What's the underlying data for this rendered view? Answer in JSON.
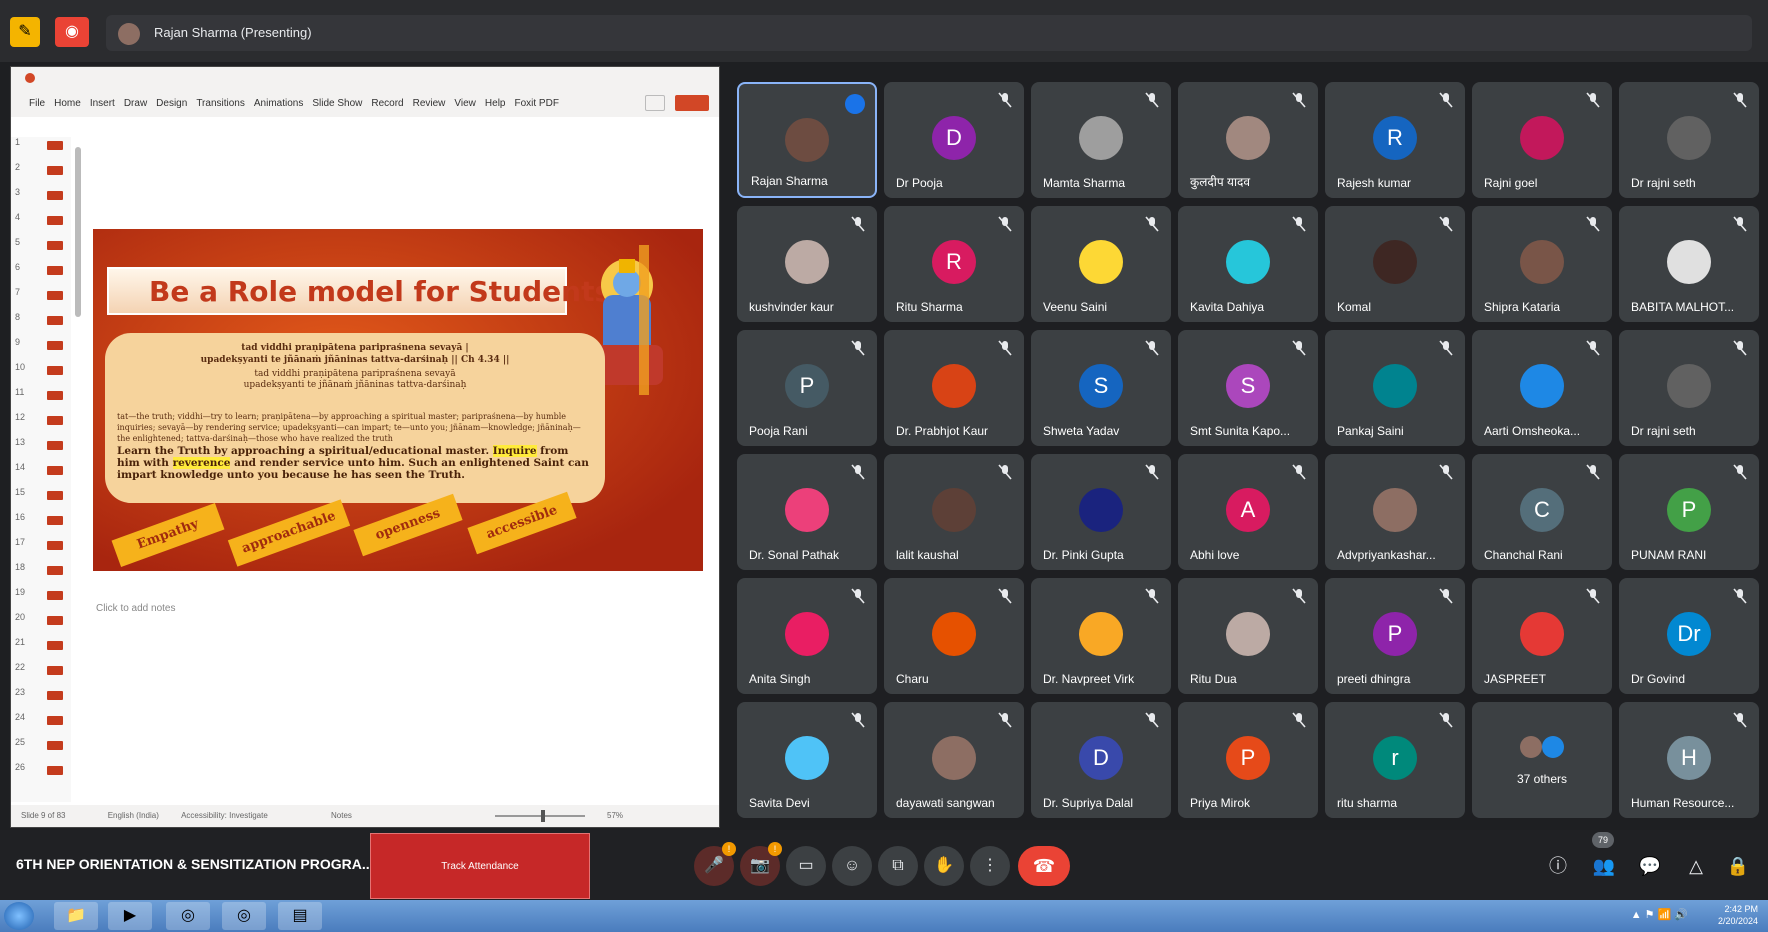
{
  "presenting": {
    "text": "Rajan Sharma (Presenting)"
  },
  "ppt": {
    "title_text": "",
    "menu": [
      "File",
      "Home",
      "Insert",
      "Draw",
      "Design",
      "Transitions",
      "Animations",
      "Slide Show",
      "Record",
      "Review",
      "View",
      "Help",
      "Foxit PDF"
    ],
    "thumb_numbers": [
      "1",
      "2",
      "3",
      "4",
      "5",
      "6",
      "7",
      "8",
      "9",
      "10",
      "11",
      "12",
      "13",
      "14",
      "15",
      "16",
      "17",
      "18",
      "19",
      "20",
      "21",
      "22",
      "23",
      "24",
      "25",
      "26"
    ],
    "notes": "Click to add notes",
    "status_left": "Slide 9 of 83",
    "status_lang": "English (India)",
    "status_access": "Accessibility: Investigate",
    "status_notes": "Notes",
    "status_zoom": "57%"
  },
  "slide": {
    "title": "Be a Role model for Students",
    "verse1": "tad viddhi praṇipātena paripraśnena sevayā |",
    "verse2": "upadekṣyanti te jñānaṁ jñāninas tattva-darśinaḥ || Ch 4.34 ||",
    "verse3": "tad viddhi praṇipātena paripraśnena sevayā",
    "verse4": "upadekṣyanti te jñānaṁ jñāninas tattva-darśinaḥ",
    "explain": "tat—the truth; viddhi—try to learn; praṇipātena—by approaching a spiritual master; paripraśnena—by humble inquiries; sevayā—by rendering service; upadekṣyanti—can impart; te—unto you; jñānam—knowledge; jñāninaḥ—the enlightened; tattva-darśinaḥ—those who have realized the truth",
    "eng1": "Learn the Truth by approaching a spiritual/educational master.",
    "eng_hl1": "Inquire",
    "eng2": "from him with",
    "eng_hl2": "reverence",
    "eng3": "and render service unto him. Such an enlightened Saint can impart knowledge unto you because he has seen the Truth.",
    "tags": [
      "Empathy",
      "approachable",
      "openness",
      "accessible"
    ]
  },
  "participants": [
    {
      "name": "Rajan Sharma",
      "initial": "",
      "color": "#6d4c41",
      "photo": true,
      "speaking": true
    },
    {
      "name": "Dr Pooja",
      "initial": "D",
      "color": "#8e24aa"
    },
    {
      "name": "Mamta Sharma",
      "initial": "",
      "color": "#9e9e9e",
      "photo": true
    },
    {
      "name": "कुलदीप यादव",
      "initial": "",
      "color": "#a1887f",
      "photo": true
    },
    {
      "name": "Rajesh kumar",
      "initial": "R",
      "color": "#1565c0"
    },
    {
      "name": "Rajni goel",
      "initial": "",
      "color": "#c2185b",
      "photo": true
    },
    {
      "name": "Dr rajni seth",
      "initial": "",
      "color": "#616161",
      "photo": true
    },
    {
      "name": "kushvinder kaur",
      "initial": "",
      "color": "#bcaaa4",
      "photo": true
    },
    {
      "name": "Ritu Sharma",
      "initial": "R",
      "color": "#d81b60"
    },
    {
      "name": "Veenu Saini",
      "initial": "",
      "color": "#fdd835",
      "photo": true
    },
    {
      "name": "Kavita Dahiya",
      "initial": "",
      "color": "#26c6da",
      "photo": true
    },
    {
      "name": "Komal",
      "initial": "",
      "color": "#3e2723",
      "photo": true
    },
    {
      "name": "Shipra Kataria",
      "initial": "",
      "color": "#795548",
      "photo": true
    },
    {
      "name": "BABITA MALHOT...",
      "initial": "",
      "color": "#e0e0e0",
      "photo": true
    },
    {
      "name": "Pooja Rani",
      "initial": "P",
      "color": "#455a64"
    },
    {
      "name": "Dr. Prabhjot Kaur",
      "initial": "",
      "color": "#d84315",
      "photo": true
    },
    {
      "name": "Shweta Yadav",
      "initial": "S",
      "color": "#1565c0"
    },
    {
      "name": "Smt Sunita Kapo...",
      "initial": "S",
      "color": "#ab47bc"
    },
    {
      "name": "Pankaj Saini",
      "initial": "",
      "color": "#00838f",
      "photo": true
    },
    {
      "name": "Aarti Omsheoka...",
      "initial": "",
      "color": "#1e88e5",
      "photo": true
    },
    {
      "name": "Dr rajni seth",
      "initial": "",
      "color": "#616161",
      "photo": true
    },
    {
      "name": "Dr. Sonal Pathak",
      "initial": "",
      "color": "#ec407a",
      "photo": true
    },
    {
      "name": "lalit kaushal",
      "initial": "",
      "color": "#5d4037",
      "photo": true
    },
    {
      "name": "Dr. Pinki Gupta",
      "initial": "",
      "color": "#1a237e",
      "photo": true
    },
    {
      "name": "Abhi love",
      "initial": "A",
      "color": "#d81b60"
    },
    {
      "name": "Advpriyankashar...",
      "initial": "",
      "color": "#8d6e63",
      "photo": true
    },
    {
      "name": "Chanchal Rani",
      "initial": "C",
      "color": "#546e7a"
    },
    {
      "name": "PUNAM RANI",
      "initial": "P",
      "color": "#43a047"
    },
    {
      "name": "Anita Singh",
      "initial": "",
      "color": "#e91e63",
      "photo": true
    },
    {
      "name": "Charu",
      "initial": "",
      "color": "#e65100",
      "photo": true
    },
    {
      "name": "Dr. Navpreet Virk",
      "initial": "",
      "color": "#f9a825",
      "photo": true
    },
    {
      "name": "Ritu Dua",
      "initial": "",
      "color": "#bcaaa4",
      "photo": true
    },
    {
      "name": "preeti dhingra",
      "initial": "P",
      "color": "#8e24aa"
    },
    {
      "name": "JASPREET",
      "initial": "",
      "color": "#e53935",
      "photo": true
    },
    {
      "name": "Dr Govind",
      "initial": "Dr",
      "color": "#0288d1"
    },
    {
      "name": "Savita Devi",
      "initial": "",
      "color": "#4fc3f7",
      "photo": true
    },
    {
      "name": "dayawati sangwan",
      "initial": "",
      "color": "#8d6e63",
      "photo": true
    },
    {
      "name": "Dr. Supriya Dalal",
      "initial": "D",
      "color": "#3949ab"
    },
    {
      "name": "Priya Mirok",
      "initial": "P",
      "color": "#e64a19"
    },
    {
      "name": "ritu sharma",
      "initial": "r",
      "color": "#00897b"
    },
    {
      "name": "37 others",
      "initial": "",
      "color": "",
      "others": true
    },
    {
      "name": "Human Resource...",
      "initial": "H",
      "color": "#78909c"
    }
  ],
  "bottom": {
    "meeting_title": "6TH NEP ORIENTATION & SENSITIZATION PROGRA...",
    "track": "Track Attendance",
    "participant_count": "79"
  },
  "taskbar": {
    "time": "2:42 PM",
    "date": "2/20/2024"
  }
}
